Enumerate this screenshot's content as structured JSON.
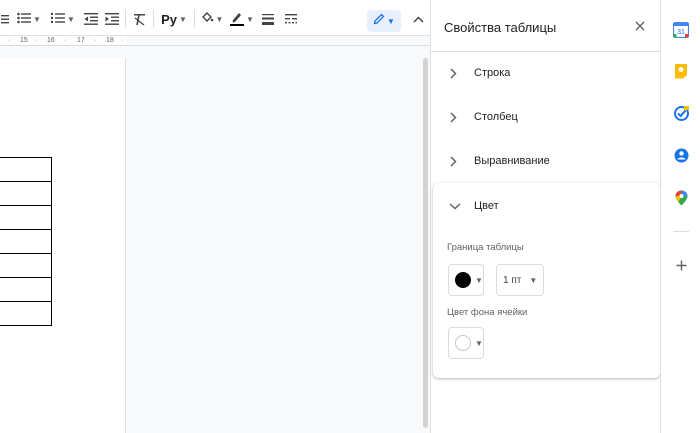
{
  "toolbar": {
    "icons": [
      "align-left-icon",
      "bulleted-list-icon",
      "numbered-list-icon",
      "decrease-indent-icon",
      "increase-indent-icon",
      "clear-formatting-icon",
      "spellcheck-icon",
      "fill-color-icon",
      "border-color-icon",
      "border-width-icon",
      "border-dash-icon",
      "editing-mode-icon",
      "collapse-toolbar-icon"
    ],
    "spellcheck_label": "Py",
    "accent_color": "#1a73e8"
  },
  "ruler": {
    "marks": [
      "15",
      "16",
      "17",
      "18"
    ]
  },
  "document": {
    "table_rows": 7
  },
  "side_panel": {
    "title": "Свойства таблицы",
    "sections": [
      {
        "label": "Строка",
        "expanded": false
      },
      {
        "label": "Столбец",
        "expanded": false
      },
      {
        "label": "Выравнивание",
        "expanded": false
      },
      {
        "label": "Цвет",
        "expanded": true
      }
    ],
    "color": {
      "border_label": "Граница таблицы",
      "border_color": "#000000",
      "border_width": "1 пт",
      "cell_bg_label": "Цвет фона ячейки",
      "cell_bg_color": "#ffffff"
    }
  },
  "right_rail": {
    "icons": [
      "calendar-icon",
      "keep-icon",
      "tasks-icon",
      "contacts-icon",
      "maps-icon",
      "add-icon"
    ],
    "calendar_day": "31"
  }
}
